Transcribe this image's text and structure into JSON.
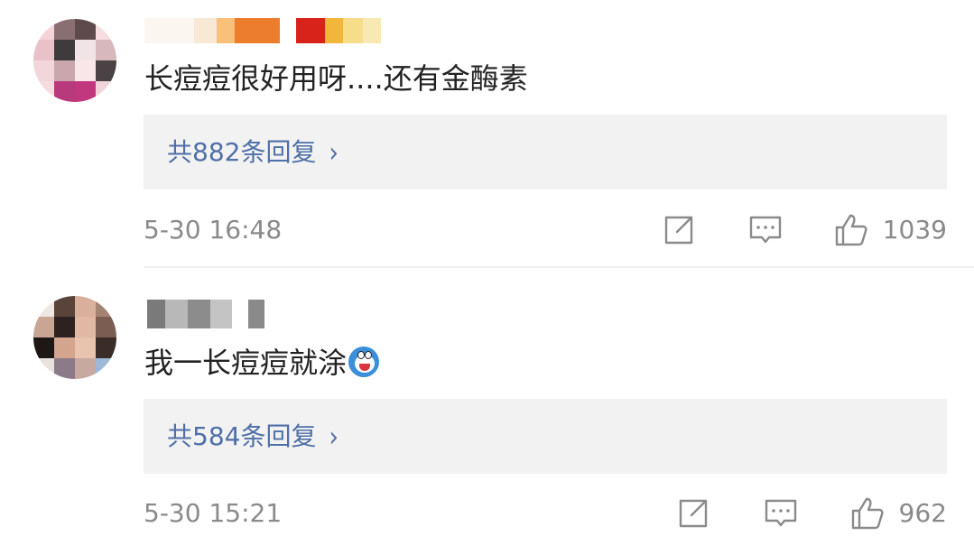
{
  "comments": [
    {
      "text": "长痘痘很好用呀....还有金酶素",
      "reply_label": "共882条回复",
      "chevron": "›",
      "timestamp": "5-30 16:48",
      "likes": "1039"
    },
    {
      "text": "我一长痘痘就涂",
      "emoji": "doraemon-emoji",
      "reply_label": "共584条回复",
      "chevron": "›",
      "timestamp": "5-30 15:21",
      "likes": "962"
    }
  ],
  "icons": {
    "share": "share-icon",
    "comment": "comment-icon",
    "like": "like-icon"
  },
  "colors": {
    "reply_link": "#4e6fa8",
    "reply_bg": "#f2f2f2",
    "meta_text": "#8a8a8a",
    "icon_stroke": "#8a8a8a"
  }
}
